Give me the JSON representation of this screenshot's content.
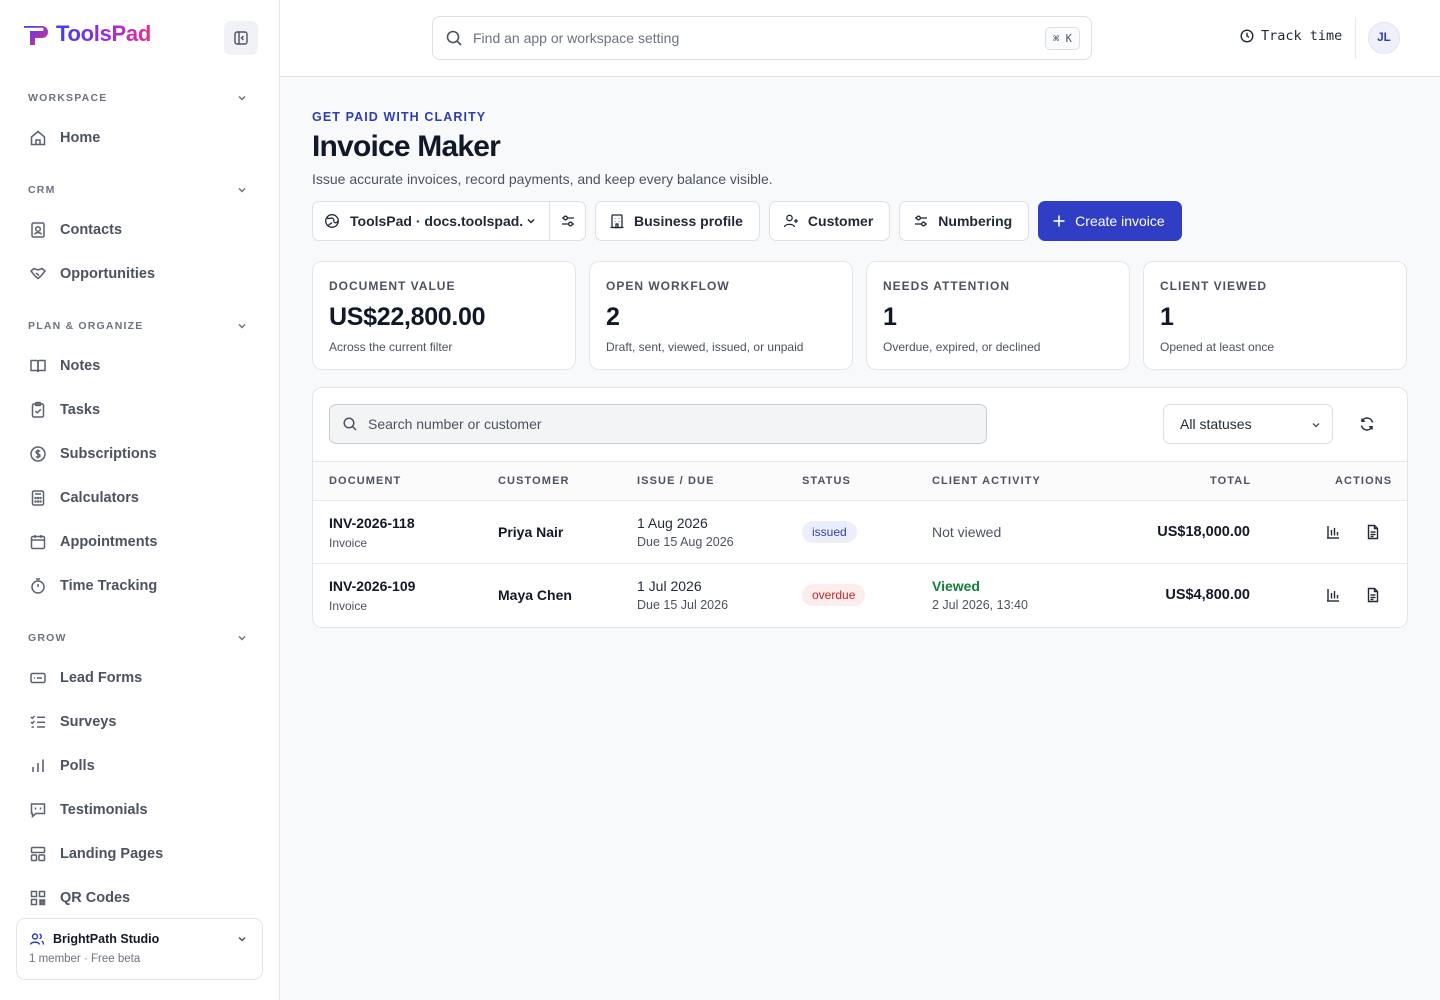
{
  "app": {
    "name": "ToolsPad",
    "brand_colors": [
      "#3b3ff0",
      "#a12bd8",
      "#ec2e8a"
    ]
  },
  "sidebar": {
    "sections": [
      {
        "label": "WORKSPACE",
        "items": [
          {
            "label": "Home",
            "icon": "home-icon"
          }
        ]
      },
      {
        "label": "CRM",
        "items": [
          {
            "label": "Contacts",
            "icon": "contacts-icon"
          },
          {
            "label": "Opportunities",
            "icon": "handshake-icon"
          }
        ]
      },
      {
        "label": "PLAN & ORGANIZE",
        "items": [
          {
            "label": "Notes",
            "icon": "notes-icon"
          },
          {
            "label": "Tasks",
            "icon": "clipboard-check-icon"
          },
          {
            "label": "Subscriptions",
            "icon": "dollar-circle-icon"
          },
          {
            "label": "Calculators",
            "icon": "calculator-icon"
          },
          {
            "label": "Appointments",
            "icon": "calendar-icon"
          },
          {
            "label": "Time Tracking",
            "icon": "stopwatch-icon"
          }
        ]
      },
      {
        "label": "GROW",
        "items": [
          {
            "label": "Lead Forms",
            "icon": "form-icon"
          },
          {
            "label": "Surveys",
            "icon": "checklist-icon"
          },
          {
            "label": "Polls",
            "icon": "bar-chart-icon"
          },
          {
            "label": "Testimonials",
            "icon": "quote-bubble-icon"
          },
          {
            "label": "Landing Pages",
            "icon": "layout-icon"
          },
          {
            "label": "QR Codes",
            "icon": "qr-code-icon"
          }
        ]
      }
    ],
    "workspace": {
      "name": "BrightPath Studio",
      "meta": "1 member · Free beta"
    }
  },
  "topbar": {
    "search_placeholder": "Find an app or workspace setting",
    "shortcut": "⌘ K",
    "track_time": "Track time",
    "avatar_initials": "JL"
  },
  "page": {
    "eyebrow": "GET PAID WITH CLARITY",
    "title": "Invoice Maker",
    "subtitle": "Issue accurate invoices, record payments, and keep every balance visible.",
    "toolbar": {
      "profile": "ToolsPad · docs.toolspad.",
      "business_profile": "Business profile",
      "customer": "Customer",
      "numbering": "Numbering",
      "create": "Create invoice"
    },
    "accent_color": "#2f3ec4"
  },
  "stats": [
    {
      "label": "DOCUMENT VALUE",
      "value": "US$22,800.00",
      "note": "Across the current filter"
    },
    {
      "label": "OPEN WORKFLOW",
      "value": "2",
      "note": "Draft, sent, viewed, issued, or unpaid"
    },
    {
      "label": "NEEDS ATTENTION",
      "value": "1",
      "note": "Overdue, expired, or declined"
    },
    {
      "label": "CLIENT VIEWED",
      "value": "1",
      "note": "Opened at least once"
    }
  ],
  "list": {
    "search_placeholder": "Search number or customer",
    "status_filter": "All statuses",
    "columns": [
      "DOCUMENT",
      "CUSTOMER",
      "ISSUE / DUE",
      "STATUS",
      "CLIENT ACTIVITY",
      "TOTAL",
      "ACTIONS"
    ],
    "rows": [
      {
        "number": "INV-2026-118",
        "type": "Invoice",
        "customer": "Priya Nair",
        "issue": "1 Aug 2026",
        "due": "Due 15 Aug 2026",
        "status": "issued",
        "activity": "Not viewed",
        "activity_time": "",
        "total": "US$18,000.00"
      },
      {
        "number": "INV-2026-109",
        "type": "Invoice",
        "customer": "Maya Chen",
        "issue": "1 Jul 2026",
        "due": "Due 15 Jul 2026",
        "status": "overdue",
        "activity": "Viewed",
        "activity_time": "2 Jul 2026, 13:40",
        "total": "US$4,800.00"
      }
    ]
  }
}
